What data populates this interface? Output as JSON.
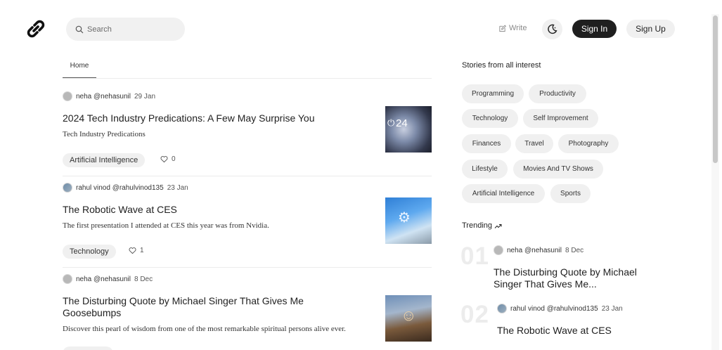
{
  "header": {
    "search_placeholder": "Search",
    "write_label": "Write",
    "sign_in": "Sign In",
    "sign_up": "Sign Up"
  },
  "feed": {
    "tab_home": "Home",
    "posts": [
      {
        "author": "neha @nehasunil",
        "date": "29 Jan",
        "title": "2024 Tech Industry Predications: A Few May Surprise You",
        "desc": "Tech Industry Predications",
        "tag": "Artificial Intelligence",
        "likes": "0",
        "thumb_text": "24"
      },
      {
        "author": "rahul vinod @rahulvinod135",
        "date": "23 Jan",
        "title": "The Robotic Wave at CES",
        "desc": "The first presentation I attended at CES this year was from Nvidia.",
        "tag": "Technology",
        "likes": "1"
      },
      {
        "author": "neha @nehasunil",
        "date": "8 Dec",
        "title": "The Disturbing Quote by Michael Singer That Gives Me Goosebumps",
        "desc": "Discover this pearl of wisdom from one of the most remarkable spiritual persons alive ever."
      }
    ]
  },
  "sidebar": {
    "stories_title": "Stories from all interest",
    "interests": [
      "Programming",
      "Productivity",
      "Technology",
      "Self Improvement",
      "Finances",
      "Travel",
      "Photography",
      "Lifestyle",
      "Movies And TV Shows",
      "Artificial Intelligence",
      "Sports"
    ],
    "trending_title": "Trending",
    "trending": [
      {
        "num": "01",
        "author": "neha @nehasunil",
        "date": "8 Dec",
        "title": "The Disturbing Quote by Michael Singer That Gives Me..."
      },
      {
        "num": "02",
        "author": "rahul vinod @rahulvinod135",
        "date": "23 Jan",
        "title": "The Robotic Wave at CES"
      }
    ]
  },
  "colors": {
    "accent_dark": "#1f1f1f",
    "chip_bg": "#f0f0f0"
  }
}
